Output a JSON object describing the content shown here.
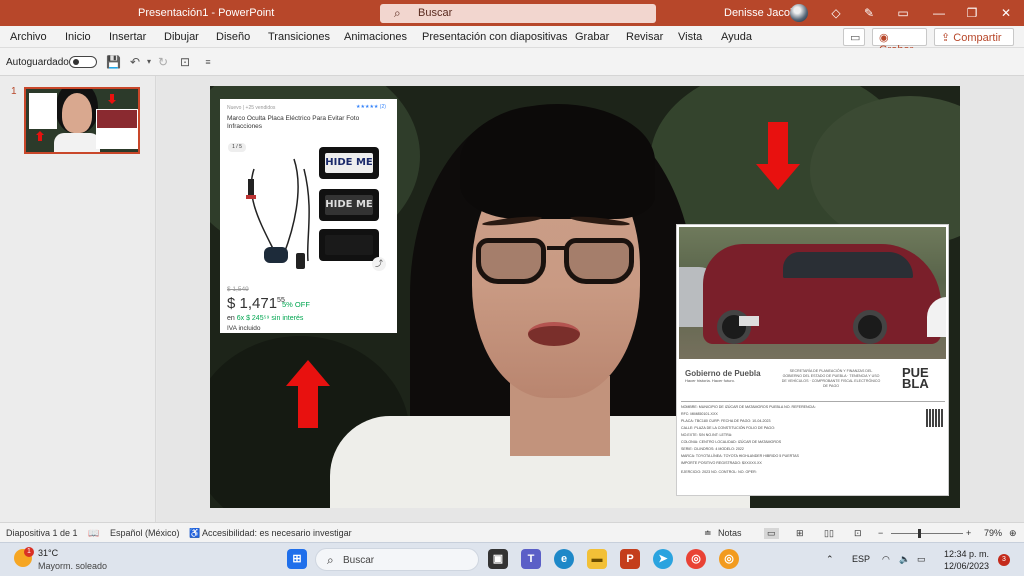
{
  "window": {
    "title": "Presentación1 - PowerPoint",
    "search_placeholder": "Buscar",
    "user_name": "Denisse Jacobo"
  },
  "menu": {
    "items": [
      "Archivo",
      "Inicio",
      "Insertar",
      "Dibujar",
      "Diseño",
      "Transiciones",
      "Animaciones",
      "Presentación con diapositivas",
      "Grabar",
      "Revisar",
      "Vista",
      "Ayuda"
    ],
    "record_label": "Grabar",
    "share_label": "Compartir"
  },
  "quick_access": {
    "autosave_label": "Autoguardado",
    "autosave_on": false
  },
  "thumbnails": {
    "slide_number": "1"
  },
  "slide": {
    "ad": {
      "meta": "Nuevo | +25 vendidos",
      "rating_text": "★★★★★ (2)",
      "title": "Marco Oculta Placa Eléctrico Para Evitar Foto Infracciones",
      "image_counter": "1 / 5",
      "plate_text_1": "HIDE ME",
      "plate_text_2": "HIDE ME",
      "old_price": "$ 1,549",
      "price_main": "$ 1,471",
      "price_cents": "55",
      "discount": "5% OFF",
      "installments_prefix": "en ",
      "installments_green": "6x $ 245⁵⁹ sin interés",
      "tax_note": "IVA incluido"
    },
    "document": {
      "gov_name": "Gobierno de Puebla",
      "gov_sub": "Hacer historia. Hacer futuro.",
      "header_text": "SECRETARÍA DE PLANEACIÓN Y FINANZAS DEL GOBIERNO DEL ESTADO DE PUEBLA · TENENCIA Y USO DE VEHÍCULOS · COMPROBANTE FISCAL ELECTRÓNICO DE PAGO",
      "logo_text": "PUE BLA",
      "rows": [
        "NOMBRE:   MUNICIPIO DE IZÚCAR DE MATAMOROS PUEBLA          NO. REFERENCIA:",
        "RFC:   MIM850101-XXX",
        "PLACA:   TBC180          CURP:          FECHA DE PAGO:  10-04-2023",
        "CALLE:   PLAZA DE LA CONSTITUCIÓN          FOLIO DE PAGO:",
        "NO.EXTE:   S/N          NO.INT:          LETRA:",
        "COLONIA:   CENTRO          LOCALIDAD:  IZÚCAR DE MATAMOROS",
        "SERIE:          CILINDROS:  4          MODELO:  2022",
        "MARCA:   TOYOTA          LÍNEA:  TOYOTA HIGHLANDER HIBRIDO 5 PUERTAS",
        "IMPORTE POSITIVO REGISTRADO: $XXXXX.XX",
        "EJERCICIO:   2023          NO. CONTROL:          NO. OPER:"
      ]
    }
  },
  "status": {
    "slide_info": "Diapositiva 1 de 1",
    "language": "Español (México)",
    "accessibility": "Accesibilidad: es necesario investigar",
    "notes_label": "Notas",
    "zoom": "79%"
  },
  "taskbar": {
    "weather_badge": "1",
    "temperature": "31°C",
    "weather_desc": "Mayorm. soleado",
    "search_placeholder": "Buscar",
    "language": "ESP",
    "time": "12:34 p. m.",
    "date": "12/06/2023",
    "notification_count": "3"
  },
  "colors": {
    "accent": "#b7472a",
    "arrow": "#e8110f"
  }
}
